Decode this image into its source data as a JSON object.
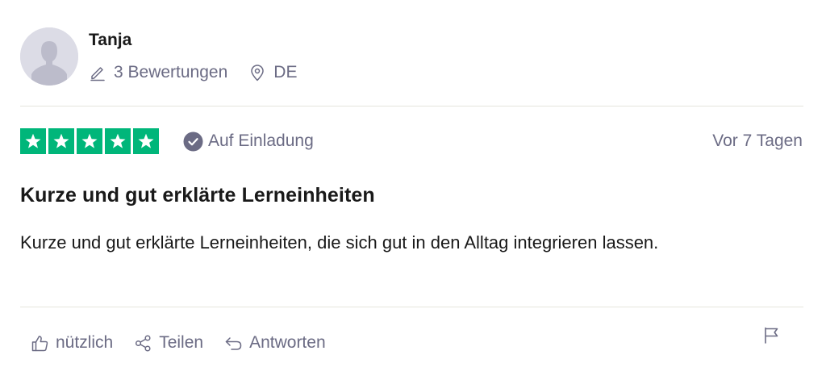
{
  "reviewer": {
    "name": "Tanja",
    "review_count": "3 Bewertungen",
    "country": "DE"
  },
  "rating": {
    "stars": 5,
    "max_stars": 5,
    "star_color": "#00b67a"
  },
  "verification": {
    "label": "Auf Einladung"
  },
  "date": "Vor 7 Tagen",
  "review": {
    "title": "Kurze und gut erklärte Lerneinheiten",
    "body": "Kurze und gut erklärte Lerneinheiten, die sich gut in den Alltag integrieren lassen."
  },
  "actions": {
    "useful_label": "nützlich",
    "share_label": "Teilen",
    "reply_label": "Antworten"
  },
  "icons": {
    "pencil": "pencil-icon",
    "location": "location-pin-icon",
    "verified": "check-circle-icon",
    "thumbs_up": "thumbs-up-icon",
    "share": "share-icon",
    "reply": "reply-icon",
    "flag": "flag-icon"
  },
  "colors": {
    "text_primary": "#191919",
    "text_secondary": "#6b6b84",
    "divider": "#e5e5dd",
    "avatar_bg": "#dcdce6"
  }
}
